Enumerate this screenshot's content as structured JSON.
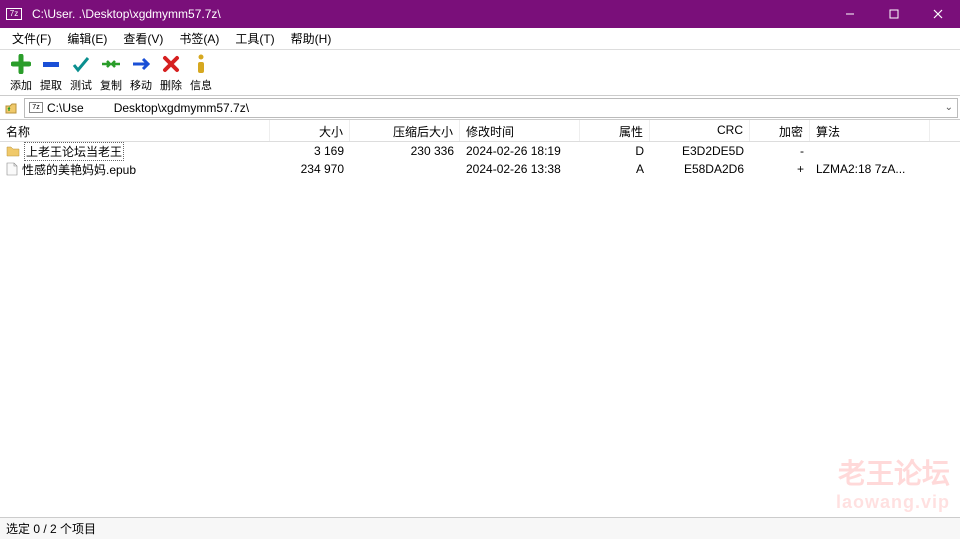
{
  "title": "C:\\User.      .\\Desktop\\xgdmymm57.7z\\",
  "menu": [
    "文件(F)",
    "编辑(E)",
    "查看(V)",
    "书签(A)",
    "工具(T)",
    "帮助(H)"
  ],
  "toolbar": [
    {
      "label": "添加",
      "icon": "plus"
    },
    {
      "label": "提取",
      "icon": "minus"
    },
    {
      "label": "测试",
      "icon": "check"
    },
    {
      "label": "复制",
      "icon": "copy"
    },
    {
      "label": "移动",
      "icon": "move"
    },
    {
      "label": "删除",
      "icon": "delete"
    },
    {
      "label": "信息",
      "icon": "info"
    }
  ],
  "address_left": "C:\\Use",
  "address_right": "Desktop\\xgdmymm57.7z\\",
  "columns": [
    "名称",
    "大小",
    "压缩后大小",
    "修改时间",
    "属性",
    "CRC",
    "加密",
    "算法"
  ],
  "rows": [
    {
      "name": "上老王论坛当老王",
      "type": "folder",
      "selected": true,
      "size": "3 169",
      "psize": "230 336",
      "date": "2024-02-26 18:19",
      "attr": "D",
      "crc": "E3D2DE5D",
      "enc": "-",
      "alg": ""
    },
    {
      "name": "性感的美艳妈妈.epub",
      "type": "file",
      "selected": false,
      "size": "234 970",
      "psize": "",
      "date": "2024-02-26 13:38",
      "attr": "A",
      "crc": "E58DA2D6",
      "enc": "+",
      "alg": "LZMA2:18 7zA..."
    }
  ],
  "status": "选定 0 / 2 个项目",
  "watermark": {
    "line1": "老王论坛",
    "line2": "laowang.vip"
  }
}
